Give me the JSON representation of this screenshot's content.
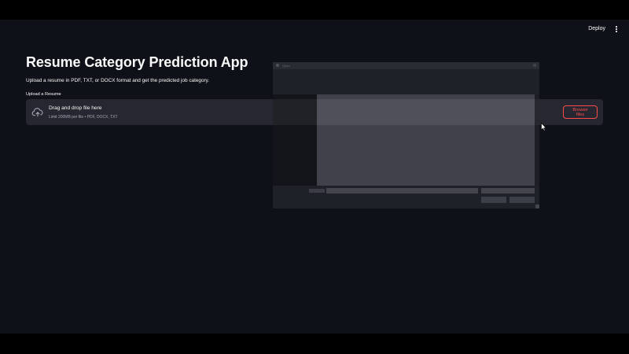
{
  "toolbar": {
    "deploy_label": "Deploy",
    "menu_icon": "kebab-menu-icon"
  },
  "main": {
    "title": "Resume Category Prediction App",
    "subtitle": "Upload a resume in PDF, TXT, or DOCX format and get the predicted job category.",
    "upload_label": "Upload a Resume",
    "dropzone": {
      "icon": "cloud-upload-icon",
      "title": "Drag and drop file here",
      "subtitle": "Limit 200MB per file • PDF, DOCX, TXT",
      "browse_label": "Browse files"
    }
  },
  "dialog": {
    "title": "Open"
  },
  "colors": {
    "background": "#0e1117",
    "dropzone": "#262730",
    "accent": "#ff4b4b",
    "text": "#fafafa",
    "muted_text": "#a3a8b8"
  }
}
